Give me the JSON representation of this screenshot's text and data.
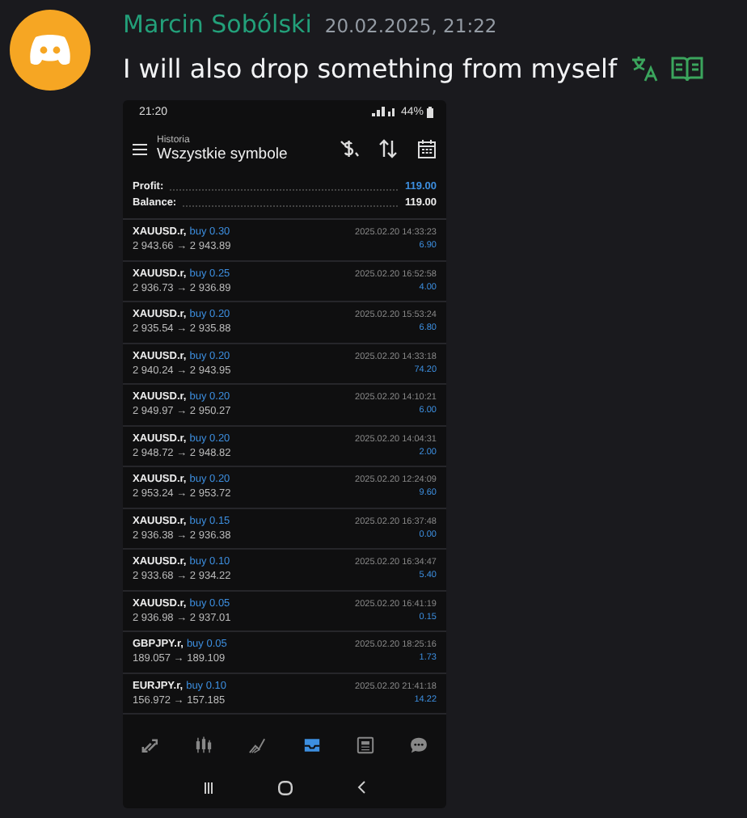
{
  "message": {
    "author": "Marcin Sobólski",
    "timestamp": "20.02.2025, 21:22",
    "text": "I will also drop something from myself"
  },
  "phone": {
    "status_bar": {
      "time": "21:20",
      "battery": "44%"
    },
    "app_bar": {
      "subtitle": "Historia",
      "title": "Wszystkie symbole"
    },
    "summary": [
      {
        "label": "Profit:",
        "value": "119.00",
        "kind": "accent"
      },
      {
        "label": "Balance:",
        "value": "119.00",
        "kind": "plain"
      }
    ],
    "trades": [
      {
        "symbol": "XAUUSD.r,",
        "side": "buy 0.30",
        "prices": "2 943.66 → 2 943.89",
        "time": "2025.02.20 14:33:23",
        "profit": "6.90"
      },
      {
        "symbol": "XAUUSD.r,",
        "side": "buy 0.25",
        "prices": "2 936.73 → 2 936.89",
        "time": "2025.02.20 16:52:58",
        "profit": "4.00"
      },
      {
        "symbol": "XAUUSD.r,",
        "side": "buy 0.20",
        "prices": "2 935.54 → 2 935.88",
        "time": "2025.02.20 15:53:24",
        "profit": "6.80"
      },
      {
        "symbol": "XAUUSD.r,",
        "side": "buy 0.20",
        "prices": "2 940.24 → 2 943.95",
        "time": "2025.02.20 14:33:18",
        "profit": "74.20"
      },
      {
        "symbol": "XAUUSD.r,",
        "side": "buy 0.20",
        "prices": "2 949.97 → 2 950.27",
        "time": "2025.02.20 14:10:21",
        "profit": "6.00"
      },
      {
        "symbol": "XAUUSD.r,",
        "side": "buy 0.20",
        "prices": "2 948.72 → 2 948.82",
        "time": "2025.02.20 14:04:31",
        "profit": "2.00"
      },
      {
        "symbol": "XAUUSD.r,",
        "side": "buy 0.20",
        "prices": "2 953.24 → 2 953.72",
        "time": "2025.02.20 12:24:09",
        "profit": "9.60"
      },
      {
        "symbol": "XAUUSD.r,",
        "side": "buy 0.15",
        "prices": "2 936.38 → 2 936.38",
        "time": "2025.02.20 16:37:48",
        "profit": "0.00"
      },
      {
        "symbol": "XAUUSD.r,",
        "side": "buy 0.10",
        "prices": "2 933.68 → 2 934.22",
        "time": "2025.02.20 16:34:47",
        "profit": "5.40"
      },
      {
        "symbol": "XAUUSD.r,",
        "side": "buy 0.05",
        "prices": "2 936.98 → 2 937.01",
        "time": "2025.02.20 16:41:19",
        "profit": "0.15"
      },
      {
        "symbol": "GBPJPY.r,",
        "side": "buy 0.05",
        "prices": "189.057 → 189.109",
        "time": "2025.02.20 18:25:16",
        "profit": "1.73"
      },
      {
        "symbol": "EURJPY.r,",
        "side": "buy 0.10",
        "prices": "156.972 → 157.185",
        "time": "2025.02.20 21:41:18",
        "profit": "14.22"
      }
    ],
    "tab_bar": [
      {
        "kind": "trade",
        "selected": false
      },
      {
        "kind": "chart",
        "selected": false
      },
      {
        "kind": "trend",
        "selected": false
      },
      {
        "kind": "inbox",
        "selected": true
      },
      {
        "kind": "news",
        "selected": false
      },
      {
        "kind": "chat",
        "selected": false
      }
    ]
  }
}
